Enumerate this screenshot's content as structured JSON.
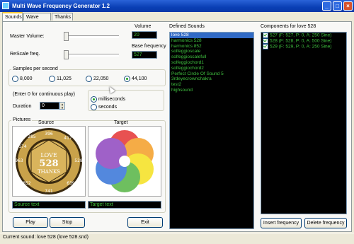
{
  "window": {
    "title": "Multi Wave Frequency Generator 1.2",
    "btn_min": "_",
    "btn_max": "□",
    "btn_close": "×"
  },
  "tabs": [
    "Sounds",
    "Wave view",
    "Thanks"
  ],
  "controls": {
    "master_volume_label": "Master Volume:",
    "rescale_label": "ReScale freq.",
    "volume_label": "Volume",
    "volume_value": "20",
    "base_freq_label": "Base frequency",
    "base_freq_value": "527"
  },
  "samples": {
    "legend": "Samples per second",
    "options": [
      "8,000",
      "11,025",
      "22,050",
      "44,100"
    ],
    "selected": "44,100"
  },
  "duration": {
    "hint": "(Enter 0 for continuous play)",
    "label": "Duration",
    "value": "0",
    "units": [
      "milliseconds",
      "seconds"
    ],
    "selected_unit": "milliseconds"
  },
  "pictures": {
    "legend": "Pictures",
    "source_label": "Source",
    "target_label": "Target",
    "source_text": "Source text",
    "target_text": "Target text",
    "seal_numbers": [
      "396",
      "417",
      "528",
      "639",
      "741",
      "852",
      "963",
      "174",
      "285"
    ],
    "seal_top": "LOVE",
    "seal_mid": "528",
    "seal_bottom": "THANKS"
  },
  "defined_sounds": {
    "label": "Defined Sounds",
    "items": [
      "love 528",
      "harmonics 528",
      "harmonics 852",
      "solfeggioscale",
      "solfeggioscalefull",
      "solfeggiochord1",
      "solfeggiochord2",
      "Perfect Circle Of Sound 5",
      "3rdeyecrownchakra",
      "test2",
      "highsound"
    ],
    "selected": "love 528"
  },
  "components": {
    "label": "Components for love 528",
    "items": [
      "527 (F: 527, P:   0, A: 250  Sine)",
      "528 (F: 528, P:   0, A: 500  Sine)",
      "529 (F: 529, P:   0, A: 250  Sine)"
    ]
  },
  "buttons": {
    "play": "Play",
    "stop": "Stop",
    "exit": "Exit",
    "insert": "Insert frequency",
    "delete": "Delete frequency"
  },
  "status": "Current sound: love 528 (love 528.snd)",
  "colors": {
    "list_text": "#3fc03f",
    "list_bg": "#000000",
    "selection": "#316ac5"
  }
}
